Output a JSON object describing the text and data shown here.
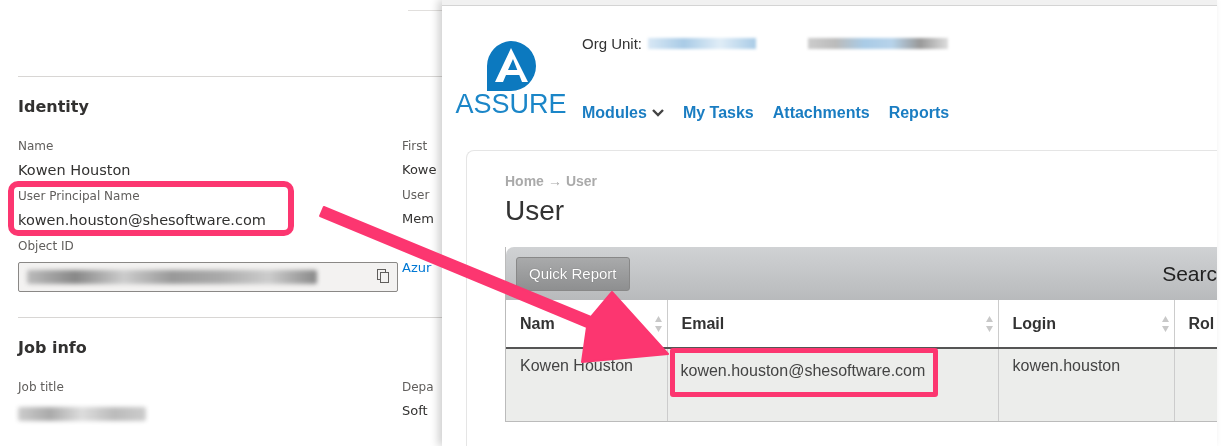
{
  "profile": {
    "sections": [
      {
        "title": "Identity",
        "left": [
          {
            "label": "Name",
            "value": "Kowen Houston"
          },
          {
            "label": "User Principal Name",
            "value": "kowen.houston@shesoftware.com",
            "highlighted": true
          },
          {
            "label": "Object ID",
            "kind": "redacted-field"
          }
        ],
        "right": [
          {
            "label": "First",
            "value": "Kowe"
          },
          {
            "label": "User",
            "value": "Mem"
          },
          {
            "value": "Azur",
            "kind": "link"
          }
        ]
      },
      {
        "title": "Job info",
        "left": [
          {
            "label": "Job title",
            "kind": "redacted"
          }
        ],
        "right": [
          {
            "label": "Depa",
            "value": "Soft"
          }
        ]
      }
    ]
  },
  "app": {
    "org_unit_label": "Org Unit:",
    "logo_text": "ASSURE",
    "nav": [
      {
        "label": "Modules",
        "dropdown": true
      },
      {
        "label": "My Tasks",
        "dropdown": false
      },
      {
        "label": "Attachments",
        "dropdown": false
      },
      {
        "label": "Reports",
        "dropdown": false
      }
    ],
    "breadcrumb": {
      "items": [
        "Home",
        "User"
      ],
      "separator": "→"
    },
    "page_title": "User",
    "toolbar": {
      "button": "Quick Report",
      "search_label": "Searc"
    },
    "table": {
      "columns": [
        {
          "label": "Nam",
          "sortable": true
        },
        {
          "label": "Email",
          "sortable": true
        },
        {
          "label": "Login",
          "sortable": true
        },
        {
          "label": "Rol"
        }
      ],
      "rows": [
        {
          "cells": [
            {
              "text": "Kowen Houston"
            },
            {
              "text": "kowen.houston@shesoftware.com",
              "highlighted": true
            },
            {
              "text": "kowen.houston"
            }
          ]
        }
      ]
    }
  }
}
